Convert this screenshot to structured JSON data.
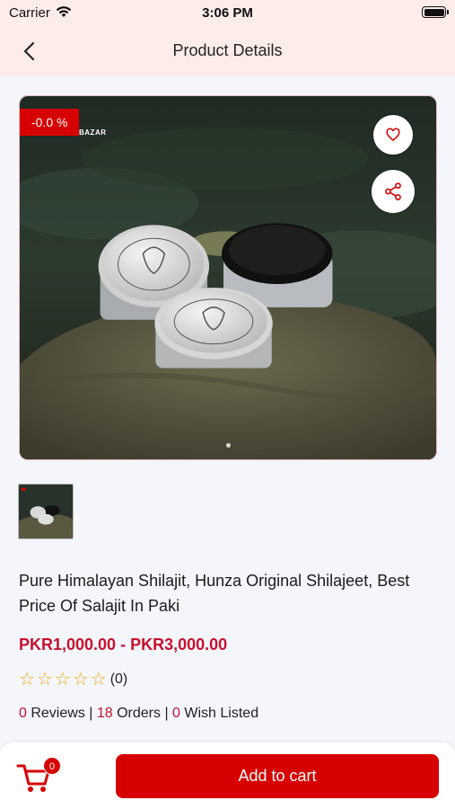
{
  "status_bar": {
    "carrier": "Carrier",
    "time": "3:06 PM"
  },
  "header": {
    "title": "Product Details"
  },
  "product": {
    "discount_badge": "-0.0 %",
    "image_brand_text": "BAZAR",
    "name": "Pure Himalayan Shilajit, Hunza Original Shilajeet, Best Price Of Salajit In Paki",
    "price_range": "PKR1,000.00 - PKR3,000.00",
    "rating": {
      "stars_filled": 0,
      "stars_total": 5,
      "count_text": "(0)"
    },
    "stats": {
      "reviews_count": "0",
      "reviews_label": " Reviews | ",
      "orders_count": "18",
      "orders_label": " Orders | ",
      "wishlist_count": "0",
      "wishlist_label": " Wish Listed"
    }
  },
  "cart": {
    "badge_count": "0",
    "add_button_label": "Add to cart"
  },
  "colors": {
    "accent": "#d60000",
    "price": "#c8102e",
    "header_bg": "#fdecea",
    "star": "#f0a500"
  },
  "icons": [
    "wifi-icon",
    "battery-icon",
    "back-arrow-icon",
    "heart-icon",
    "share-icon",
    "cart-icon"
  ]
}
